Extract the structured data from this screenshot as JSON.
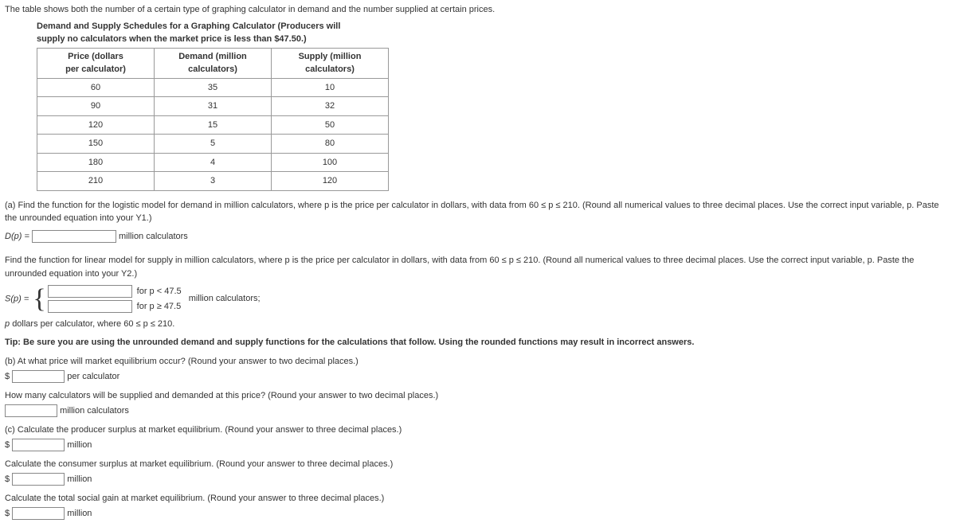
{
  "intro": "The table shows both the number of a certain type of graphing calculator in demand and the number supplied at certain prices.",
  "table_title_line1": "Demand and Supply Schedules for a Graphing Calculator (Producers will",
  "table_title_line2": "supply no calculators when the market price is less than $47.50.)",
  "columns": {
    "c1a": "Price (dollars",
    "c1b": "per calculator)",
    "c2a": "Demand (million",
    "c2b": "calculators)",
    "c3a": "Supply (million",
    "c3b": "calculators)"
  },
  "rows": [
    {
      "price": "60",
      "demand": "35",
      "supply": "10"
    },
    {
      "price": "90",
      "demand": "31",
      "supply": "32"
    },
    {
      "price": "120",
      "demand": "15",
      "supply": "50"
    },
    {
      "price": "150",
      "demand": "5",
      "supply": "80"
    },
    {
      "price": "180",
      "demand": "4",
      "supply": "100"
    },
    {
      "price": "210",
      "demand": "3",
      "supply": "120"
    }
  ],
  "qa_text": "(a) Find the function for the logistic model for demand in million calculators, where p is the price per calculator in dollars, with data from  60 ≤ p ≤ 210.  (Round all numerical values to three decimal places. Use the correct input variable, p. Paste the unrounded equation into your Y1.)",
  "d_label": "D(p) = ",
  "d_units": "million calculators",
  "supply_text": "Find the function for linear model for supply in million calculators, where p is the price per calculator in dollars, with data from  60 ≤ p ≤ 210.  (Round all numerical values to three decimal places. Use the correct input variable, p. Paste the unrounded equation into your Y2.)",
  "s_label": "S(p) = ",
  "s_cond1": "for p < 47.5",
  "s_units_mid": "million calculators;",
  "s_cond2": "for p ≥ 47.5",
  "domain_note": "p dollars per calculator, where 60 ≤ p ≤ 210.",
  "tip": "Tip: Be sure you are using the unrounded demand and supply functions for the calculations that follow. Using the rounded functions may result in incorrect answers.",
  "qb_text": "(b) At what price will market equilibrium occur? (Round your answer to two decimal places.)",
  "qb_units": "per calculator",
  "qb2_text": "How many calculators will be supplied and demanded at this price? (Round your answer to two decimal places.)",
  "qb2_units": "million calculators",
  "qc_text": "(c) Calculate the producer surplus at market equilibrium. (Round your answer to three decimal places.)",
  "qc_units": "million",
  "qc2_text": "Calculate the consumer surplus at market equilibrium. (Round your answer to three decimal places.)",
  "qc2_units": "million",
  "qc3_text": "Calculate the total social gain at market equilibrium. (Round your answer to three decimal places.)",
  "qc3_units": "million",
  "dollar": "$"
}
